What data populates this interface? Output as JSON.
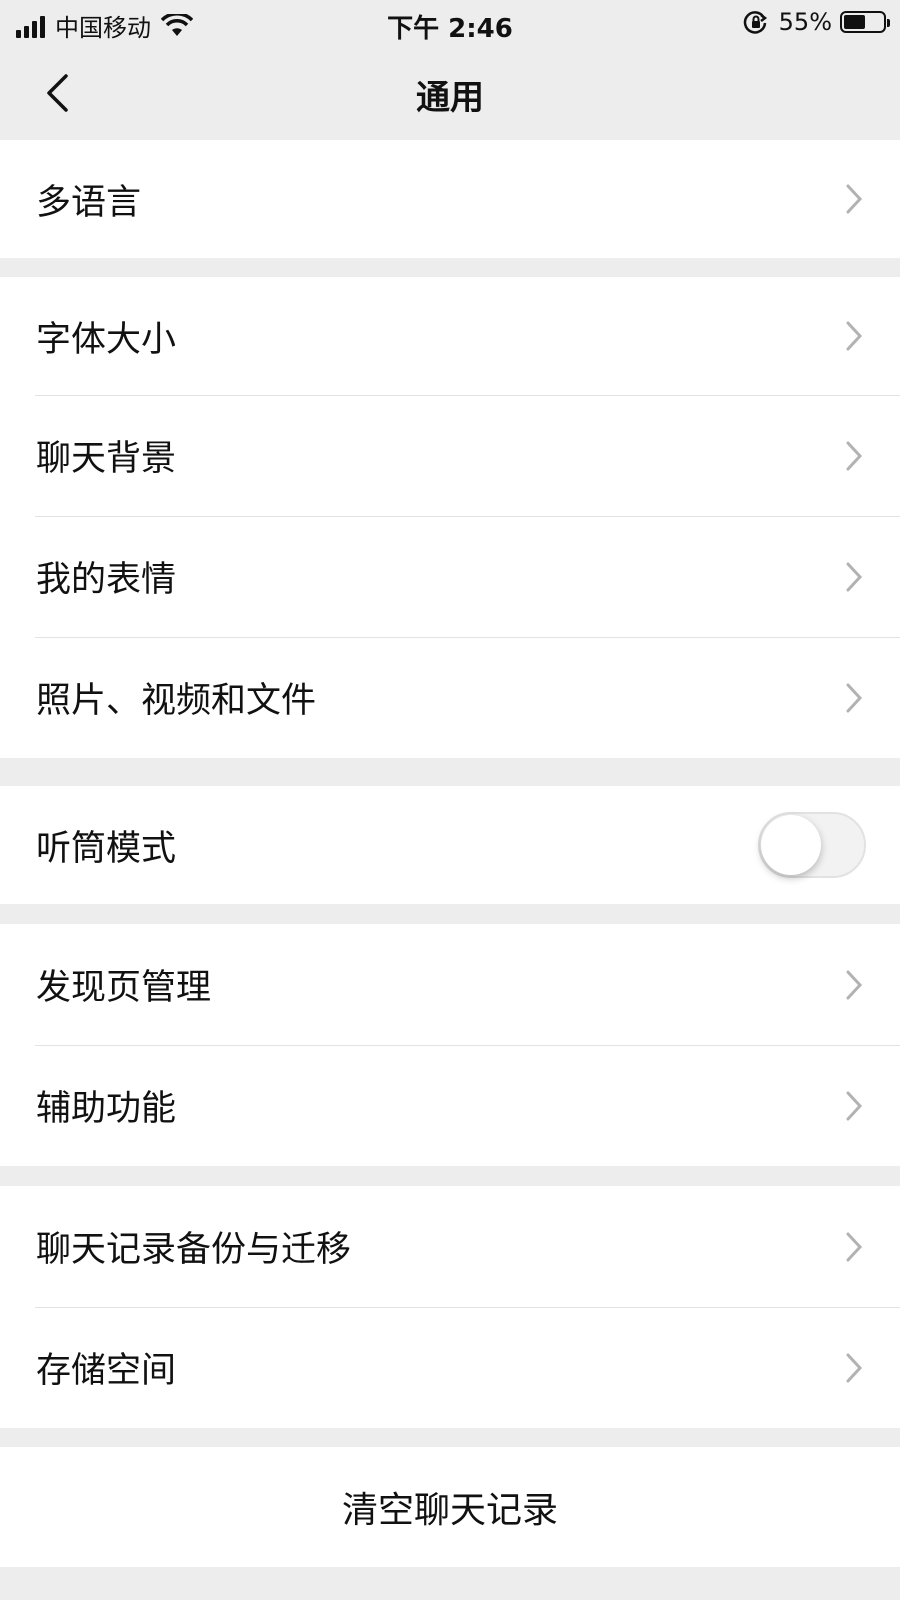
{
  "status": {
    "carrier": "中国移动",
    "time": "下午 2:46",
    "battery": "55%",
    "battery_level": 0.55
  },
  "nav": {
    "title": "通用",
    "back_icon": "chevron-left-icon"
  },
  "groups": [
    {
      "items": [
        {
          "label": "多语言",
          "accessory": "chevron"
        }
      ]
    },
    {
      "items": [
        {
          "label": "字体大小",
          "accessory": "chevron"
        },
        {
          "label": "聊天背景",
          "accessory": "chevron"
        },
        {
          "label": "我的表情",
          "accessory": "chevron"
        },
        {
          "label": "照片、视频和文件",
          "accessory": "chevron"
        }
      ]
    },
    {
      "items": [
        {
          "label": "听筒模式",
          "accessory": "toggle",
          "on": false
        }
      ]
    },
    {
      "items": [
        {
          "label": "发现页管理",
          "accessory": "chevron"
        },
        {
          "label": "辅助功能",
          "accessory": "chevron"
        }
      ]
    },
    {
      "items": [
        {
          "label": "聊天记录备份与迁移",
          "accessory": "chevron"
        },
        {
          "label": "存储空间",
          "accessory": "chevron"
        }
      ]
    }
  ],
  "clear_history": {
    "label": "清空聊天记录"
  },
  "colors": {
    "background": "#ededed",
    "cell": "#ffffff",
    "chevron": "#b2b2b2"
  }
}
